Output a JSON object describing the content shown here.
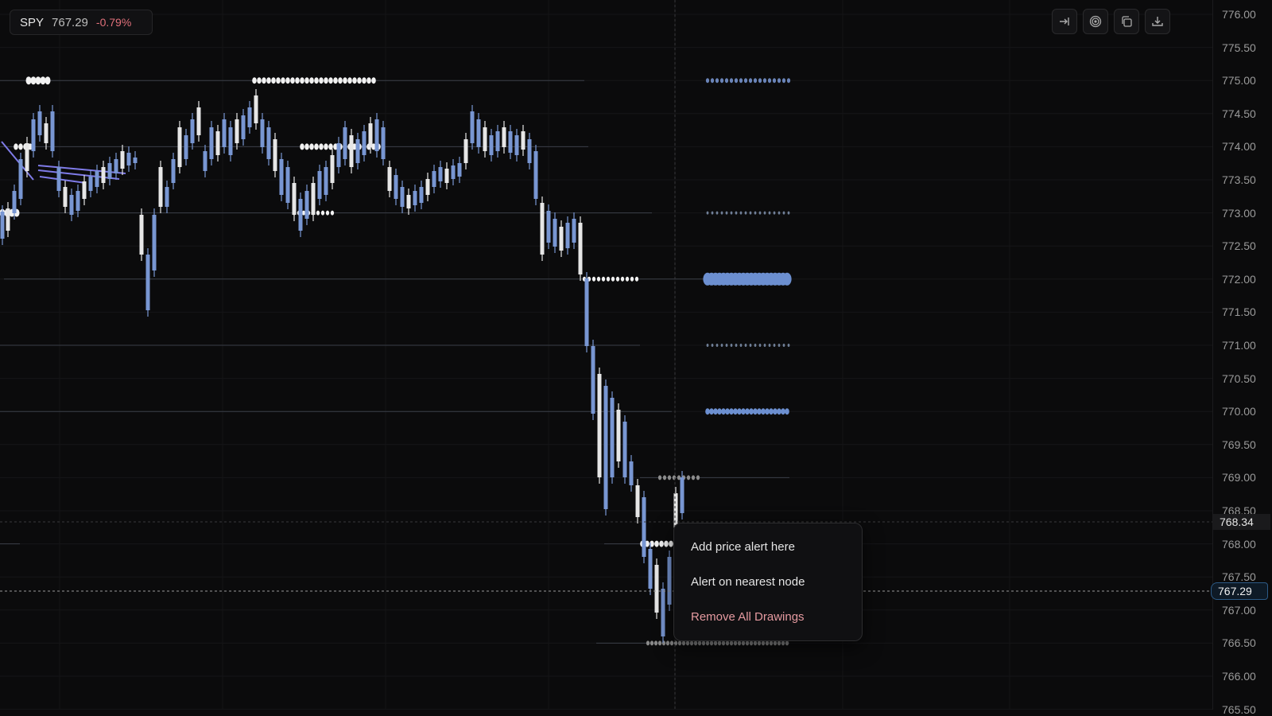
{
  "ticker": {
    "symbol": "SPY",
    "price": "767.29",
    "change": "-0.79%"
  },
  "toolbar": {
    "icons": [
      "jump-to-latest-icon",
      "target-icon",
      "copy-icon",
      "download-icon"
    ]
  },
  "price_axis": {
    "labels": [
      "776.00",
      "775.50",
      "775.00",
      "774.50",
      "774.00",
      "773.50",
      "773.00",
      "772.50",
      "772.00",
      "771.50",
      "771.00",
      "770.50",
      "770.00",
      "769.50",
      "769.00",
      "768.50",
      "768.00",
      "767.50",
      "767.00",
      "766.50",
      "766.00",
      "765.50"
    ],
    "crosshair_price": "768.34",
    "last_price": "767.29"
  },
  "context_menu": {
    "items": [
      "Add price alert here",
      "Alert on nearest node",
      "Remove All Drawings"
    ]
  },
  "colors": {
    "up": "#6f8fd0",
    "down": "#e8e8e8",
    "negative": "#e0707a",
    "danger": "#e59aa0",
    "last_price_border": "#2c5a86"
  }
}
